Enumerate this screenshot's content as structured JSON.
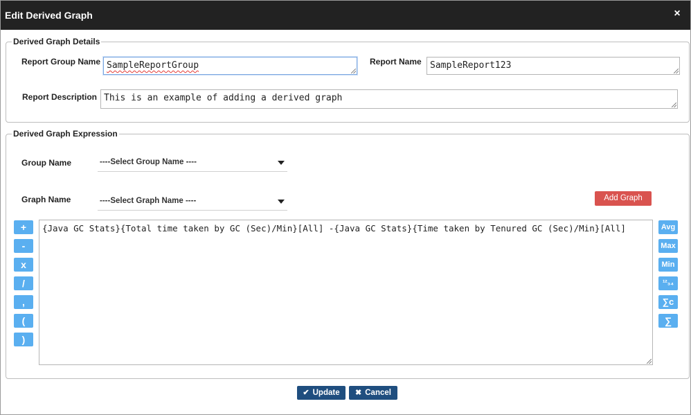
{
  "dialog": {
    "title": "Edit Derived Graph",
    "close_icon": "×"
  },
  "details": {
    "legend": "Derived Graph Details",
    "report_group_label": "Report Group Name",
    "report_group_value": "SampleReportGroup",
    "report_name_label": "Report Name",
    "report_name_value": "SampleReport123",
    "report_desc_label": "Report Description",
    "report_desc_value": "This is an example of adding a derived graph"
  },
  "expression": {
    "legend": "Derived Graph Expression",
    "group_label": "Group Name",
    "group_selected": "----Select Group Name ----",
    "graph_label": "Graph Name",
    "graph_selected": "----Select Graph Name ----",
    "add_graph": "Add Graph",
    "value": "{Java GC Stats}{Total time taken by GC (Sec)/Min}[All] -{Java GC Stats}{Time taken by Tenured GC (Sec)/Min}[All]",
    "operators": [
      "+",
      "-",
      "x",
      "/",
      ",",
      "(",
      ")"
    ],
    "functions": [
      "Avg",
      "Max",
      "Min",
      "¹²₃₄",
      "∑c",
      "∑"
    ]
  },
  "footer": {
    "update": "Update",
    "cancel": "Cancel",
    "update_icon": "✔",
    "cancel_icon": "✖"
  },
  "colors": {
    "titlebar": "#222222",
    "add_graph": "#d9534f",
    "operator_button": "#5aaff0",
    "footer_button": "#1f4e7f"
  }
}
